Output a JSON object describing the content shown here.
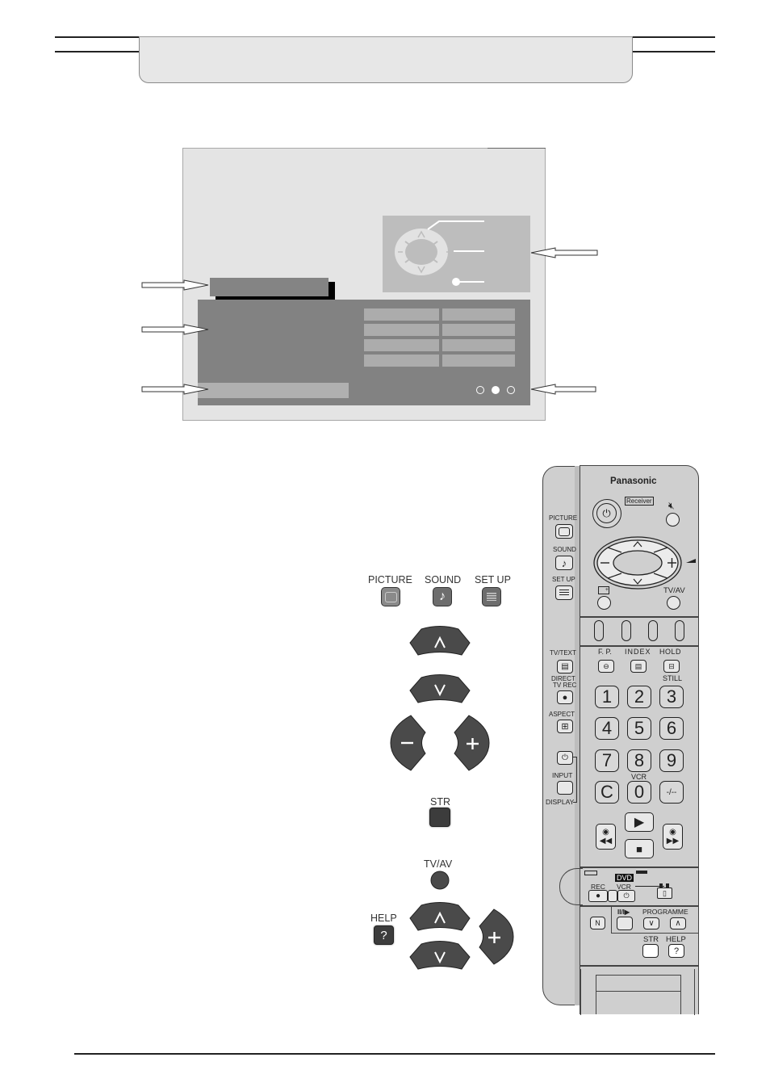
{
  "header": {
    "title": ""
  },
  "screen_diagram": {
    "help_panel": {
      "icon": "cursor-pad-icon",
      "pad_symbols": {
        "up": "^",
        "down": "v",
        "left": "−",
        "right": "+"
      }
    },
    "menu_grid_rows": 4,
    "menu_grid_cols": 2,
    "page_indicator": {
      "total": 3,
      "active": 2
    }
  },
  "button_guide": {
    "menu_buttons": [
      {
        "label": "PICTURE",
        "icon": "picture-icon"
      },
      {
        "label": "SOUND",
        "icon": "music-note-icon"
      },
      {
        "label": "SET UP",
        "icon": "list-icon"
      }
    ],
    "up_symbol": "∧",
    "down_symbol": "∨",
    "minus_symbol": "−",
    "plus_symbol": "+",
    "str_label": "STR",
    "tvav_label": "TV/AV",
    "help_label": "HELP",
    "help_symbol": "?"
  },
  "remote": {
    "brand": "Panasonic",
    "receiver_label": "Receiver",
    "side_labels": {
      "picture": "PICTURE",
      "sound": "SOUND",
      "setup": "SET UP",
      "tvtext": "TV/TEXT",
      "direct": "DIRECT",
      "tvrec": "TV REC",
      "aspect": "ASPECT",
      "input": "INPUT",
      "display": "DISPLAY"
    },
    "tvav_label": "TV/AV",
    "teletext_labels": [
      "F. P.",
      "INDEX",
      "HOLD"
    ],
    "still_label": "STILL",
    "keypad": [
      "1",
      "2",
      "3",
      "4",
      "5",
      "6",
      "7",
      "8",
      "9",
      "C",
      "0",
      "-/--"
    ],
    "vcr_label": "VCR",
    "dvd_label": "DVD",
    "rec_label": "REC",
    "vcr_label2": "VCR",
    "n_label": "N",
    "pause_label": "II/I▶",
    "programme_label": "PROGRAMME",
    "str_label": "STR",
    "help_label": "HELP",
    "help_symbol": "?",
    "plus": "+",
    "minus": "−",
    "up": "∧",
    "down": "∨"
  }
}
